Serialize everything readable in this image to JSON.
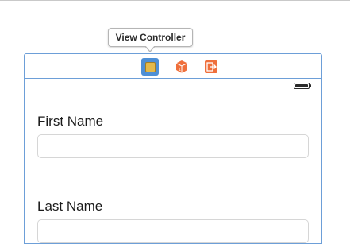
{
  "tooltip": {
    "title": "View Controller"
  },
  "dock": {
    "icons": [
      "view-controller-icon",
      "first-responder-icon",
      "exit-icon"
    ]
  },
  "colors": {
    "selection_border": "#6d9fd8",
    "view_controller_bg": "#4d8fd6",
    "accent_orange": "#ef6f3b"
  },
  "form": {
    "first_name_label": "First Name",
    "first_name_value": "",
    "last_name_label": "Last Name",
    "last_name_value": ""
  }
}
